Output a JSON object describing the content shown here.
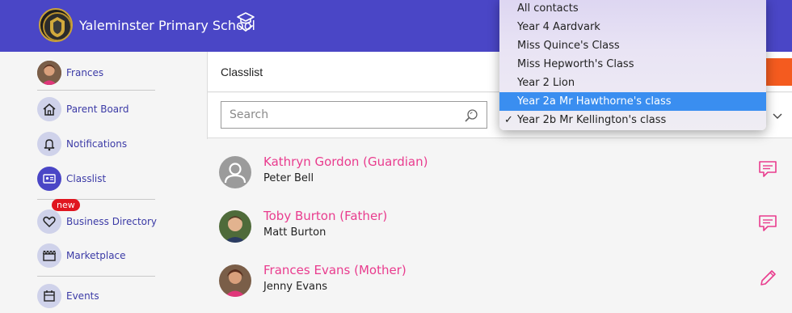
{
  "header": {
    "school_name": "Yaleminster Primary School"
  },
  "sidebar": {
    "user_name": "Frances",
    "items": [
      {
        "label": "Parent Board",
        "icon": "home-icon"
      },
      {
        "label": "Notifications",
        "icon": "bell-icon"
      },
      {
        "label": "Classlist",
        "icon": "id-card-icon"
      },
      {
        "label": "Business Directory",
        "icon": "heart-icon",
        "badge": "new"
      },
      {
        "label": "Marketplace",
        "icon": "store-icon"
      },
      {
        "label": "Events",
        "icon": "calendar-icon"
      }
    ],
    "active": "Classlist"
  },
  "main": {
    "title": "Classlist",
    "search_placeholder": "Search"
  },
  "dropdown": {
    "options": [
      "All contacts",
      "Year 4 Aardvark",
      "Miss Quince's Class",
      "Miss Hepworth's Class",
      "Year 2 Lion",
      "Year 2a Mr Hawthorne's class",
      "Year 2b Mr Kellington's class"
    ],
    "highlighted": "Year 2a Mr Hawthorne's class",
    "selected": "Year 2b Mr Kellington's class",
    "check_mark": "✓"
  },
  "contacts": [
    {
      "name": "Kathryn Gordon (Guardian)",
      "child": "Peter Bell",
      "action": "message-icon"
    },
    {
      "name": "Toby Burton (Father)",
      "child": "Matt Burton",
      "action": "message-icon"
    },
    {
      "name": "Frances Evans (Mother)",
      "child": "Jenny Evans",
      "action": "edit-icon"
    }
  ],
  "colors": {
    "brand": "#4a46c6",
    "accent_pink": "#e93c8e",
    "orange": "#f45b1f",
    "highlight": "#3a8ef0"
  }
}
